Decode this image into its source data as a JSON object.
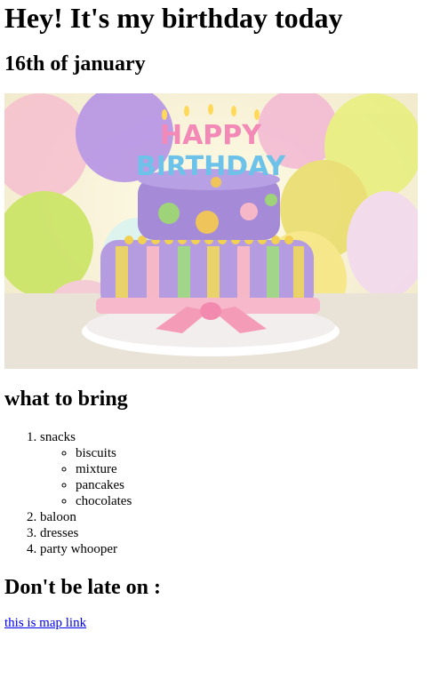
{
  "heading": "Hey! It's my birthday today",
  "date": "16th of january",
  "image": {
    "topper_top": "HAPPY",
    "topper_bottom": "BIRTHDAY",
    "colors": {
      "bg": "#f4e9a0",
      "cake_top": "#a48ad7",
      "cake_bottom": "#b59be0",
      "ribbon": "#f7b8cc",
      "plate": "#ffffff"
    }
  },
  "bring_heading": "what to bring",
  "bring_list": [
    {
      "label": "snacks",
      "sub": [
        "biscuits",
        "mixture",
        "pancakes",
        "chocolates"
      ]
    },
    {
      "label": "baloon"
    },
    {
      "label": "dresses"
    },
    {
      "label": "party whooper"
    }
  ],
  "late_heading": "Don't be late on :",
  "map_link": "this is map link"
}
